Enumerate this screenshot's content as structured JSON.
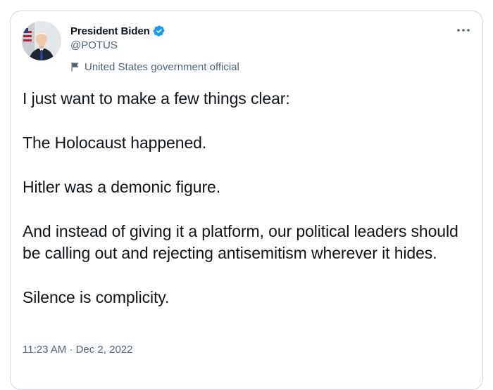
{
  "author": {
    "display_name": "President Biden",
    "handle": "@POTUS",
    "affiliation": "United States government official",
    "verified": true,
    "avatar_icon": "portrait-avatar",
    "verified_icon": "verified-badge-icon",
    "verified_color": "#1d9bf0"
  },
  "menu": {
    "icon": "more-horizontal-icon"
  },
  "tweet": {
    "paragraphs": [
      "I just want to make a few things clear:",
      "The Holocaust happened.",
      "Hitler was a demonic figure.",
      "And instead of giving it a platform, our political leaders should be calling out and rejecting antisemitism wherever it hides.",
      "Silence is complicity."
    ],
    "timestamp": "11:23 AM · Dec 2, 2022"
  },
  "colors": {
    "text_primary": "#0f1419",
    "text_secondary": "#536471",
    "border": "#cfd9de",
    "background": "#ffffff"
  }
}
